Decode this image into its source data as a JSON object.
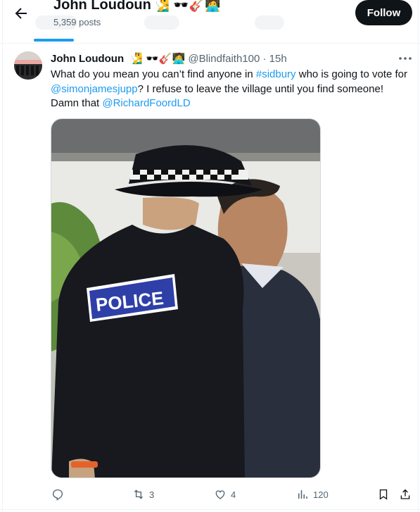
{
  "header": {
    "name": "John Loudoun",
    "emojis": "🧏‍♂️ 🕶️🎸🧑‍💻",
    "posts": "5,359 posts",
    "follow_label": "Follow"
  },
  "tweet": {
    "display_name": "John Loudoun",
    "emojis": "🧏‍♂️ 🕶️🎸🧑‍💻",
    "handle": "@Blindfaith100",
    "separator": "·",
    "time": "15h",
    "text_parts": {
      "p1": "What do you mean you can’t find anyone in ",
      "hashtag": "#sidbury",
      "p2": " who is going to vote for ",
      "mention1": "@simonjamesjupp",
      "p3": "? I refuse to leave the village until you find someone! Damn that ",
      "mention2": "@RichardFoordLD"
    },
    "photo_badge_text": "POLICE",
    "actions": {
      "reply_count": "",
      "retweet_count": "3",
      "like_count": "4",
      "views_count": "120"
    }
  },
  "colors": {
    "link": "#1d9bf0",
    "text": "#0f1419",
    "muted": "#536471",
    "follow_bg": "#0f1419"
  },
  "icons": [
    "back-arrow-icon",
    "more-icon",
    "reply-icon",
    "retweet-icon",
    "like-icon",
    "views-icon",
    "bookmark-icon",
    "share-icon"
  ]
}
